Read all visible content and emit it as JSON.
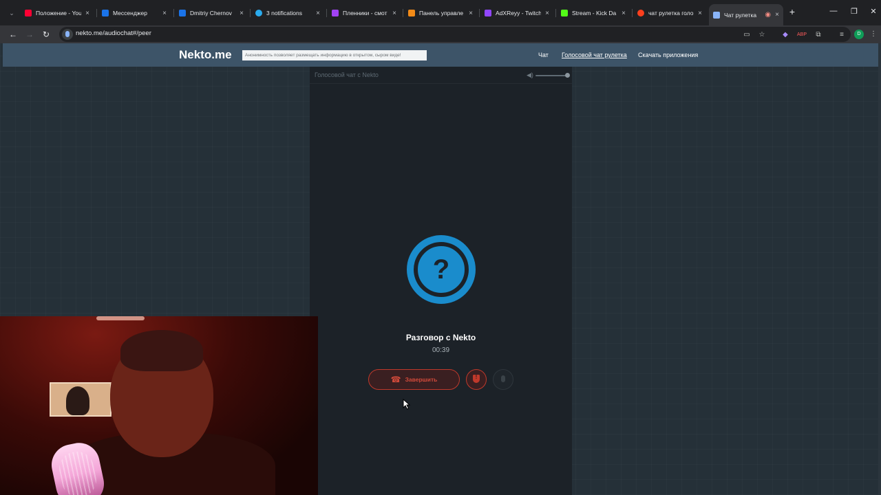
{
  "browser": {
    "tabs": [
      {
        "title": "Положение - You",
        "color": "#ff0033"
      },
      {
        "title": "Мессенджер",
        "color": "#1a73e8"
      },
      {
        "title": "Dmitriy Chernov",
        "color": "#1a73e8"
      },
      {
        "title": "3 notifications",
        "color": "#2aabee"
      },
      {
        "title": "Пленники - смот",
        "color": "#a142f4"
      },
      {
        "title": "Панель управле",
        "color": "#f28b18"
      },
      {
        "title": "AdXReyy - Twitch",
        "color": "#9146ff"
      },
      {
        "title": "Stream - Kick Da",
        "color": "#53fc18"
      },
      {
        "title": "чат рулетка голо",
        "color": "#fc3f1d"
      },
      {
        "title": "Чат рулетка",
        "color": "#8ab4f8"
      }
    ],
    "url": "nekto.me/audiochat#/peer",
    "profile_initial": "D"
  },
  "site": {
    "logo": "Nekto.me",
    "notice": "Анонимность позволяет размещать информацию в открытом, сыром виде!",
    "nav": {
      "chat": "Чат",
      "voice": "Голосовой чат рулетка",
      "download": "Скачать приложения"
    }
  },
  "panel": {
    "title": "Голосовой чат с Nekto",
    "avatar_glyph": "?",
    "peer_name": "Разговор с Nekto",
    "timer": "00:39",
    "end_button": "Завершить",
    "volume_level": 1.0
  },
  "colors": {
    "accent": "#1a8ccc",
    "danger": "#c0392b",
    "header": "#3d5468",
    "background": "#253038"
  }
}
